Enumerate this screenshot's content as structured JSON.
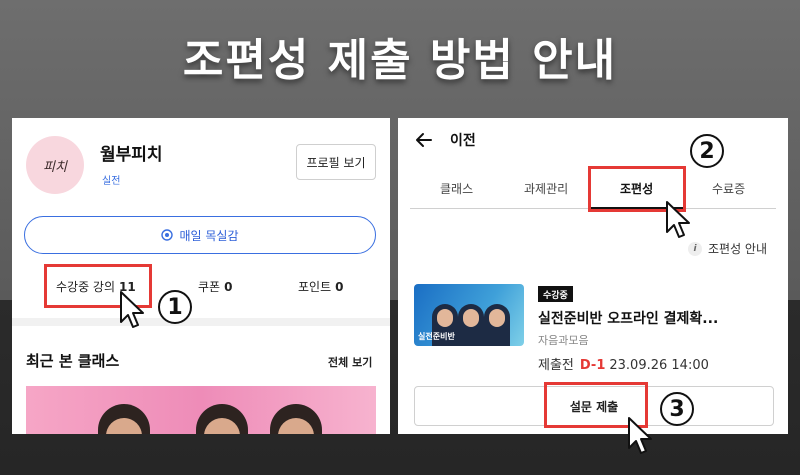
{
  "headline": "조편성 제출 방법 안내",
  "left_panel": {
    "avatar_text": "피치",
    "username": "월부피치",
    "level": "실전",
    "profile_button": "프로필 보기",
    "daily_button": "매일 목실감",
    "stats": {
      "courses_label": "수강중 강의",
      "courses_value": "11",
      "coupon_label": "쿠폰",
      "coupon_value": "0",
      "point_label": "포인트",
      "point_value": "0"
    },
    "recent_title": "최근 본 클래스",
    "see_all": "전체 보기"
  },
  "right_panel": {
    "back_label": "이전",
    "tabs": [
      {
        "label": "클래스",
        "active": false
      },
      {
        "label": "과제관리",
        "active": false
      },
      {
        "label": "조편성",
        "active": true
      },
      {
        "label": "수료증",
        "active": false
      }
    ],
    "info_label": "조편성 안내",
    "course": {
      "thumbnail_caption": "실전준비반",
      "status_badge": "수강중",
      "title": "실전준비반 오프라인 결제확...",
      "subtitle": "자음과모음",
      "deadline_status": "제출전",
      "dday": "D-1",
      "deadline": "23.09.26 14:00"
    },
    "survey_button": "설문 제출"
  },
  "steps": [
    "1",
    "2",
    "3"
  ],
  "colors": {
    "highlight": "#e53935",
    "accent_blue": "#3a6fe0",
    "dday_red": "#e53935"
  },
  "icons": [
    "back-arrow-icon",
    "target-icon",
    "info-icon",
    "cursor-pointer-icon"
  ]
}
